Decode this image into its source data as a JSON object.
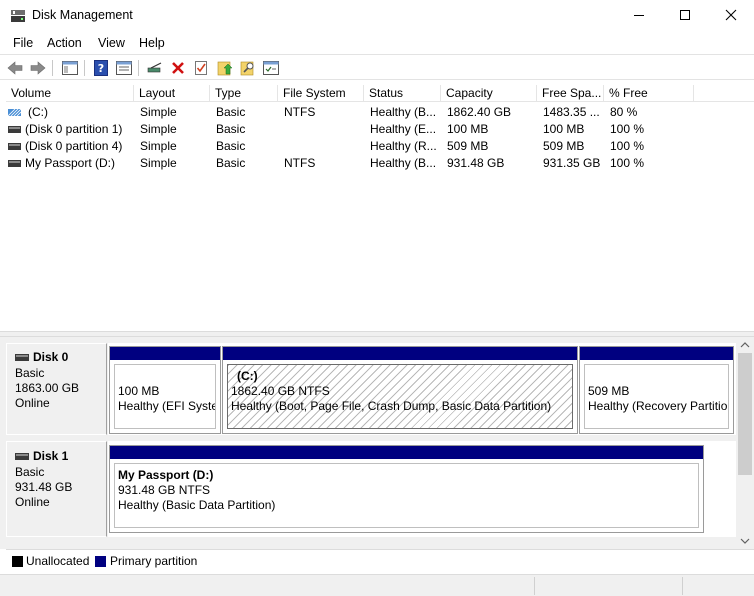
{
  "window": {
    "title": "Disk Management"
  },
  "menu": [
    "File",
    "Action",
    "View",
    "Help"
  ],
  "toolbar_icons": [
    "back-icon",
    "forward-icon",
    "console-tree-icon",
    "help-icon",
    "properties-icon",
    "connect-icon",
    "delete-icon",
    "check-icon",
    "folder-up-icon",
    "search-folder-icon",
    "settings-icon"
  ],
  "columns": [
    "Volume",
    "Layout",
    "Type",
    "File System",
    "Status",
    "Capacity",
    "Free Spa...",
    "% Free"
  ],
  "volumes": [
    {
      "volume": "(C:)",
      "layout": "Simple",
      "type": "Basic",
      "fs": "NTFS",
      "status": "Healthy (B...",
      "capacity": "1862.40 GB",
      "free": "1483.35 ...",
      "pct": "80 %"
    },
    {
      "volume": "(Disk 0 partition 1)",
      "layout": "Simple",
      "type": "Basic",
      "fs": "",
      "status": "Healthy (E...",
      "capacity": "100 MB",
      "free": "100 MB",
      "pct": "100 %"
    },
    {
      "volume": "(Disk 0 partition 4)",
      "layout": "Simple",
      "type": "Basic",
      "fs": "",
      "status": "Healthy (R...",
      "capacity": "509 MB",
      "free": "509 MB",
      "pct": "100 %"
    },
    {
      "volume": "My Passport (D:)",
      "layout": "Simple",
      "type": "Basic",
      "fs": "NTFS",
      "status": "Healthy (B...",
      "capacity": "931.48 GB",
      "free": "931.35 GB",
      "pct": "100 %"
    }
  ],
  "disks": [
    {
      "name": "Disk 0",
      "type": "Basic",
      "size": "1863.00 GB",
      "state": "Online",
      "partitions": [
        {
          "title": "",
          "line1": "100 MB",
          "line2": "Healthy (EFI System Partition)"
        },
        {
          "title": "(C:)",
          "line1": "1862.40 GB NTFS",
          "line2": "Healthy (Boot, Page File, Crash Dump, Basic Data Partition)"
        },
        {
          "title": "",
          "line1": "509 MB",
          "line2": "Healthy (Recovery Partition)"
        }
      ]
    },
    {
      "name": "Disk 1",
      "type": "Basic",
      "size": "931.48 GB",
      "state": "Online",
      "partitions": [
        {
          "title": "My Passport  (D:)",
          "line1": "931.48 GB NTFS",
          "line2": "Healthy (Basic Data Partition)"
        }
      ]
    }
  ],
  "legend": [
    {
      "label": "Unallocated",
      "color": "#000000"
    },
    {
      "label": "Primary partition",
      "color": "#000080"
    }
  ]
}
